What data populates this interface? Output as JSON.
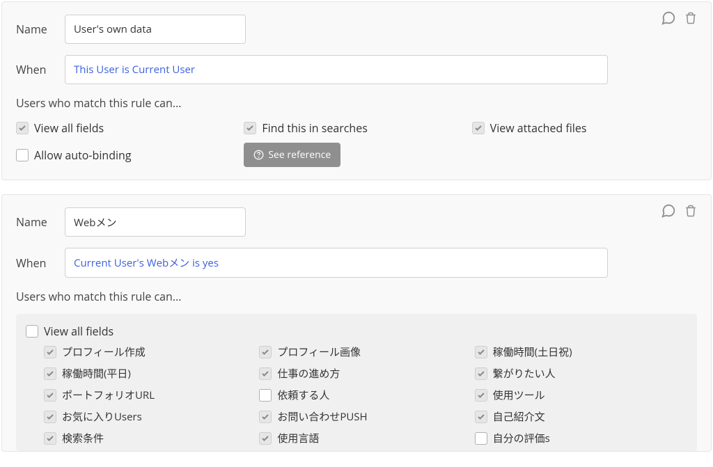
{
  "labels": {
    "name": "Name",
    "when": "When",
    "subtitle": "Users who match this rule can...",
    "view_all_fields": "View all fields",
    "find_in_searches": "Find this in searches",
    "view_attached": "View attached files",
    "allow_auto_binding": "Allow auto-binding",
    "see_reference": "See reference"
  },
  "rules": [
    {
      "name": "User's own data",
      "when": "This User is Current User",
      "view_all_fields_checked": true,
      "find_in_searches_checked": true,
      "view_attached_checked": true,
      "allow_auto_binding_checked": false,
      "fields_expanded": false
    },
    {
      "name": "Webメン",
      "when": "Current User's Webメン is yes",
      "view_all_fields_checked": false,
      "fields_expanded": true,
      "fields": [
        {
          "label": "プロフィール作成",
          "checked": true
        },
        {
          "label": "プロフィール画像",
          "checked": true
        },
        {
          "label": "稼働時間(土日祝)",
          "checked": true
        },
        {
          "label": "稼働時間(平日)",
          "checked": true
        },
        {
          "label": "仕事の進め方",
          "checked": true
        },
        {
          "label": "繋がりたい人",
          "checked": true
        },
        {
          "label": "ポートフォリオURL",
          "checked": true
        },
        {
          "label": "依頼する人",
          "checked": false
        },
        {
          "label": "使用ツール",
          "checked": true
        },
        {
          "label": "お気に入りUsers",
          "checked": true
        },
        {
          "label": "お問い合わせPUSH",
          "checked": true
        },
        {
          "label": "自己紹介文",
          "checked": true
        },
        {
          "label": "検索条件",
          "checked": true
        },
        {
          "label": "使用言語",
          "checked": true
        },
        {
          "label": "自分の評価s",
          "checked": false
        }
      ]
    }
  ]
}
